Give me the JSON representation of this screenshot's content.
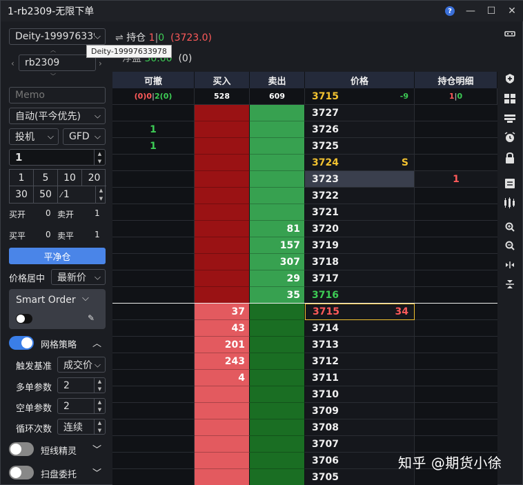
{
  "window": {
    "title": "1-rb2309-无限下单"
  },
  "account": {
    "selected": "Deity-19997633978",
    "tooltip": "Deity-19997633978"
  },
  "position_summary": {
    "label": "持仓",
    "long": "1",
    "sep": "|",
    "short": "0",
    "avg": "(3723.0)"
  },
  "pnl": {
    "partial_label": "浮盈",
    "value": "30.00",
    "extra": "(0)"
  },
  "instrument": {
    "symbol": "rb2309"
  },
  "memo": {
    "placeholder": "Memo"
  },
  "order_type": {
    "selected": "自动(平今优先)"
  },
  "hedge": {
    "selected": "投机"
  },
  "tif": {
    "selected": "GFD"
  },
  "quantity": {
    "value": "1"
  },
  "qty_presets": [
    "1",
    "5",
    "10",
    "20",
    "30",
    "50"
  ],
  "multiplier": {
    "symbol": "⁄",
    "value": "1"
  },
  "counts": {
    "buy_open_label": "买开",
    "buy_open": "0",
    "sell_open_label": "卖开",
    "sell_open": "1",
    "buy_close_label": "买平",
    "buy_close": "0",
    "sell_close_label": "卖平",
    "sell_close": "1"
  },
  "flatten_button": "平净仓",
  "center_price": {
    "label": "价格居中",
    "selected": "最新价"
  },
  "smart_order": {
    "label": "Smart Order",
    "enabled": false
  },
  "grid_strategy": {
    "label": "网格策略",
    "enabled": true,
    "trigger_label": "触发基准",
    "trigger_value": "成交价",
    "long_param_label": "多单参数",
    "long_param": "2",
    "short_param_label": "空单参数",
    "short_param": "2",
    "loop_label": "循环次数",
    "loop_value": "连续"
  },
  "scalper": {
    "label": "短线精灵",
    "enabled": false
  },
  "sweep": {
    "label": "扫盘委托",
    "enabled": false
  },
  "ladder": {
    "headers": [
      "可撤",
      "买入",
      "卖出",
      "价格",
      "持仓明细"
    ],
    "summary": {
      "cancel_a": "(0)0",
      "cancel_sep": "|",
      "cancel_b": "2(0)",
      "buy_total": "528",
      "sell_total": "609",
      "last_price": "3715",
      "change": "-9",
      "pos_long": "1",
      "pos_sep": "|",
      "pos_short": "0"
    },
    "rows": [
      {
        "price": "3727",
        "cancel": "",
        "bid": "",
        "ask": "",
        "pos": "",
        "mark": ""
      },
      {
        "price": "3726",
        "cancel": "1",
        "bid": "",
        "ask": "",
        "pos": "",
        "mark": ""
      },
      {
        "price": "3725",
        "cancel": "1",
        "bid": "",
        "ask": "",
        "pos": "",
        "mark": ""
      },
      {
        "price": "3724",
        "cancel": "",
        "bid": "",
        "ask": "",
        "pos": "",
        "mark": "S"
      },
      {
        "price": "3723",
        "cancel": "",
        "bid": "",
        "ask": "",
        "pos": "1",
        "mark": ""
      },
      {
        "price": "3722",
        "cancel": "",
        "bid": "",
        "ask": "",
        "pos": "",
        "mark": ""
      },
      {
        "price": "3721",
        "cancel": "",
        "bid": "",
        "ask": "",
        "pos": "",
        "mark": ""
      },
      {
        "price": "3720",
        "cancel": "",
        "bid": "",
        "ask": "81",
        "pos": "",
        "mark": ""
      },
      {
        "price": "3719",
        "cancel": "",
        "bid": "",
        "ask": "157",
        "pos": "",
        "mark": ""
      },
      {
        "price": "3718",
        "cancel": "",
        "bid": "",
        "ask": "307",
        "pos": "",
        "mark": ""
      },
      {
        "price": "3717",
        "cancel": "",
        "bid": "",
        "ask": "29",
        "pos": "",
        "mark": ""
      },
      {
        "price": "3716",
        "cancel": "",
        "bid": "",
        "ask": "35",
        "pos": "",
        "mark": ""
      },
      {
        "price": "3715",
        "cancel": "",
        "bid": "37",
        "ask": "",
        "pos": "",
        "mark": "34"
      },
      {
        "price": "3714",
        "cancel": "",
        "bid": "43",
        "ask": "",
        "pos": "",
        "mark": ""
      },
      {
        "price": "3713",
        "cancel": "",
        "bid": "201",
        "ask": "",
        "pos": "",
        "mark": ""
      },
      {
        "price": "3712",
        "cancel": "",
        "bid": "243",
        "ask": "",
        "pos": "",
        "mark": ""
      },
      {
        "price": "3711",
        "cancel": "",
        "bid": "4",
        "ask": "",
        "pos": "",
        "mark": ""
      },
      {
        "price": "3710",
        "cancel": "",
        "bid": "",
        "ask": "",
        "pos": "",
        "mark": ""
      },
      {
        "price": "3709",
        "cancel": "",
        "bid": "",
        "ask": "",
        "pos": "",
        "mark": ""
      },
      {
        "price": "3708",
        "cancel": "",
        "bid": "",
        "ask": "",
        "pos": "",
        "mark": ""
      },
      {
        "price": "3707",
        "cancel": "",
        "bid": "",
        "ask": "",
        "pos": "",
        "mark": ""
      },
      {
        "price": "3706",
        "cancel": "",
        "bid": "",
        "ask": "",
        "pos": "",
        "mark": ""
      },
      {
        "price": "3705",
        "cancel": "",
        "bid": "",
        "ask": "",
        "pos": "",
        "mark": ""
      }
    ]
  },
  "watermark": "知乎 @期货小徐",
  "colors": {
    "bid_dark": "#9a1214",
    "bid_light": "#e35a5f",
    "ask_light": "#37a150",
    "ask_dark": "#1a6e23",
    "price_bg": "#15171c",
    "accent_blue": "#4a85e8",
    "up_red": "#ff5a5a",
    "down_green": "#3dcc55",
    "yellow": "#f2c230"
  },
  "right_toolbar_icons": [
    "keyboard-icon",
    "add-icon",
    "grid-icon",
    "print-icon",
    "alarm-icon",
    "lock-icon",
    "list-icon",
    "candlestick-icon",
    "zoom-in-icon",
    "zoom-out-icon",
    "expand-horizontal-icon",
    "expand-vertical-icon"
  ]
}
